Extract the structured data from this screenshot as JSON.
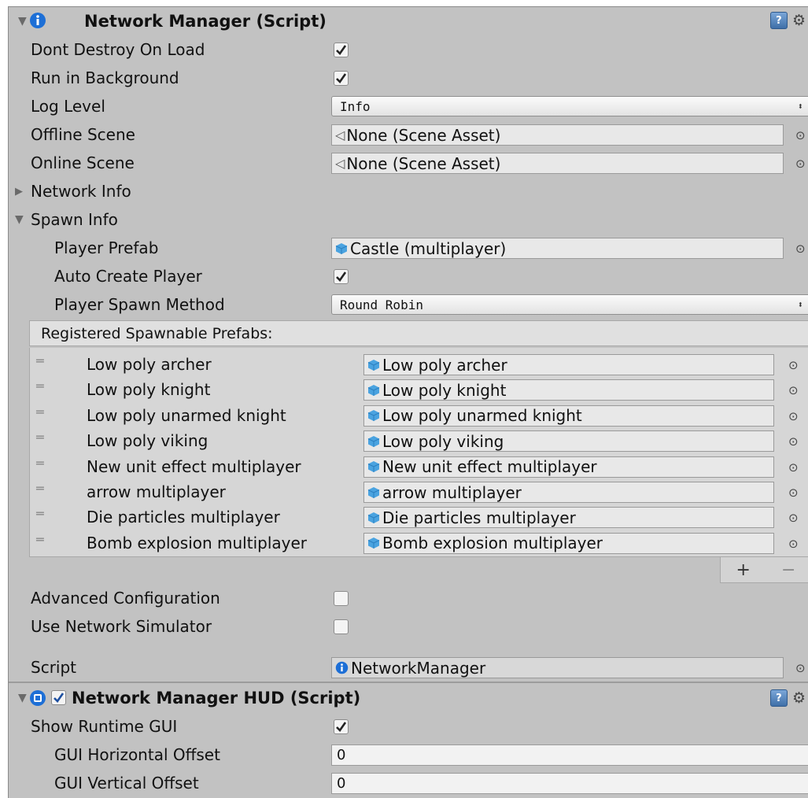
{
  "network_manager": {
    "title": "Network Manager (Script)",
    "dont_destroy_label": "Dont Destroy On Load",
    "dont_destroy_checked": true,
    "run_bg_label": "Run in Background",
    "run_bg_checked": true,
    "log_level_label": "Log Level",
    "log_level_value": "Info",
    "offline_scene_label": "Offline Scene",
    "offline_scene_value": "None (Scene Asset)",
    "online_scene_label": "Online Scene",
    "online_scene_value": "None (Scene Asset)",
    "network_info_label": "Network Info",
    "spawn_info_label": "Spawn Info",
    "player_prefab_label": "Player Prefab",
    "player_prefab_value": "Castle (multiplayer)",
    "auto_create_label": "Auto Create Player",
    "auto_create_checked": true,
    "spawn_method_label": "Player Spawn Method",
    "spawn_method_value": "Round Robin",
    "registered_header": "Registered Spawnable Prefabs:",
    "prefabs": [
      {
        "name": "Low poly archer",
        "value": "Low poly archer"
      },
      {
        "name": "Low poly knight",
        "value": "Low poly knight"
      },
      {
        "name": "Low poly unarmed knight",
        "value": "Low poly unarmed knight"
      },
      {
        "name": "Low poly viking",
        "value": "Low poly viking"
      },
      {
        "name": "New unit effect multiplayer",
        "value": "New unit effect multiplayer"
      },
      {
        "name": "arrow multiplayer",
        "value": "arrow multiplayer"
      },
      {
        "name": "Die particles multiplayer",
        "value": "Die particles multiplayer"
      },
      {
        "name": "Bomb explosion multiplayer",
        "value": "Bomb explosion multiplayer"
      }
    ],
    "add_label": "+",
    "remove_label": "−",
    "advanced_label": "Advanced Configuration",
    "advanced_checked": false,
    "simulator_label": "Use Network Simulator",
    "simulator_checked": false,
    "script_label": "Script",
    "script_value": "NetworkManager"
  },
  "network_hud": {
    "title": "Network Manager HUD (Script)",
    "enabled": true,
    "show_gui_label": "Show Runtime GUI",
    "show_gui_checked": true,
    "h_offset_label": "GUI Horizontal Offset",
    "h_offset_value": "0",
    "v_offset_label": "GUI Vertical Offset",
    "v_offset_value": "0"
  },
  "icons": {
    "help": "help-icon",
    "settings": "gear-icon",
    "info": "info-icon",
    "prefab": "prefab-cube-icon",
    "scene": "scene-asset-icon",
    "picker": "object-picker-icon"
  },
  "colors": {
    "panel": "#c2c2c2",
    "info_blue": "#1d6fd6",
    "prefab_blue": "#4aa3e0"
  }
}
